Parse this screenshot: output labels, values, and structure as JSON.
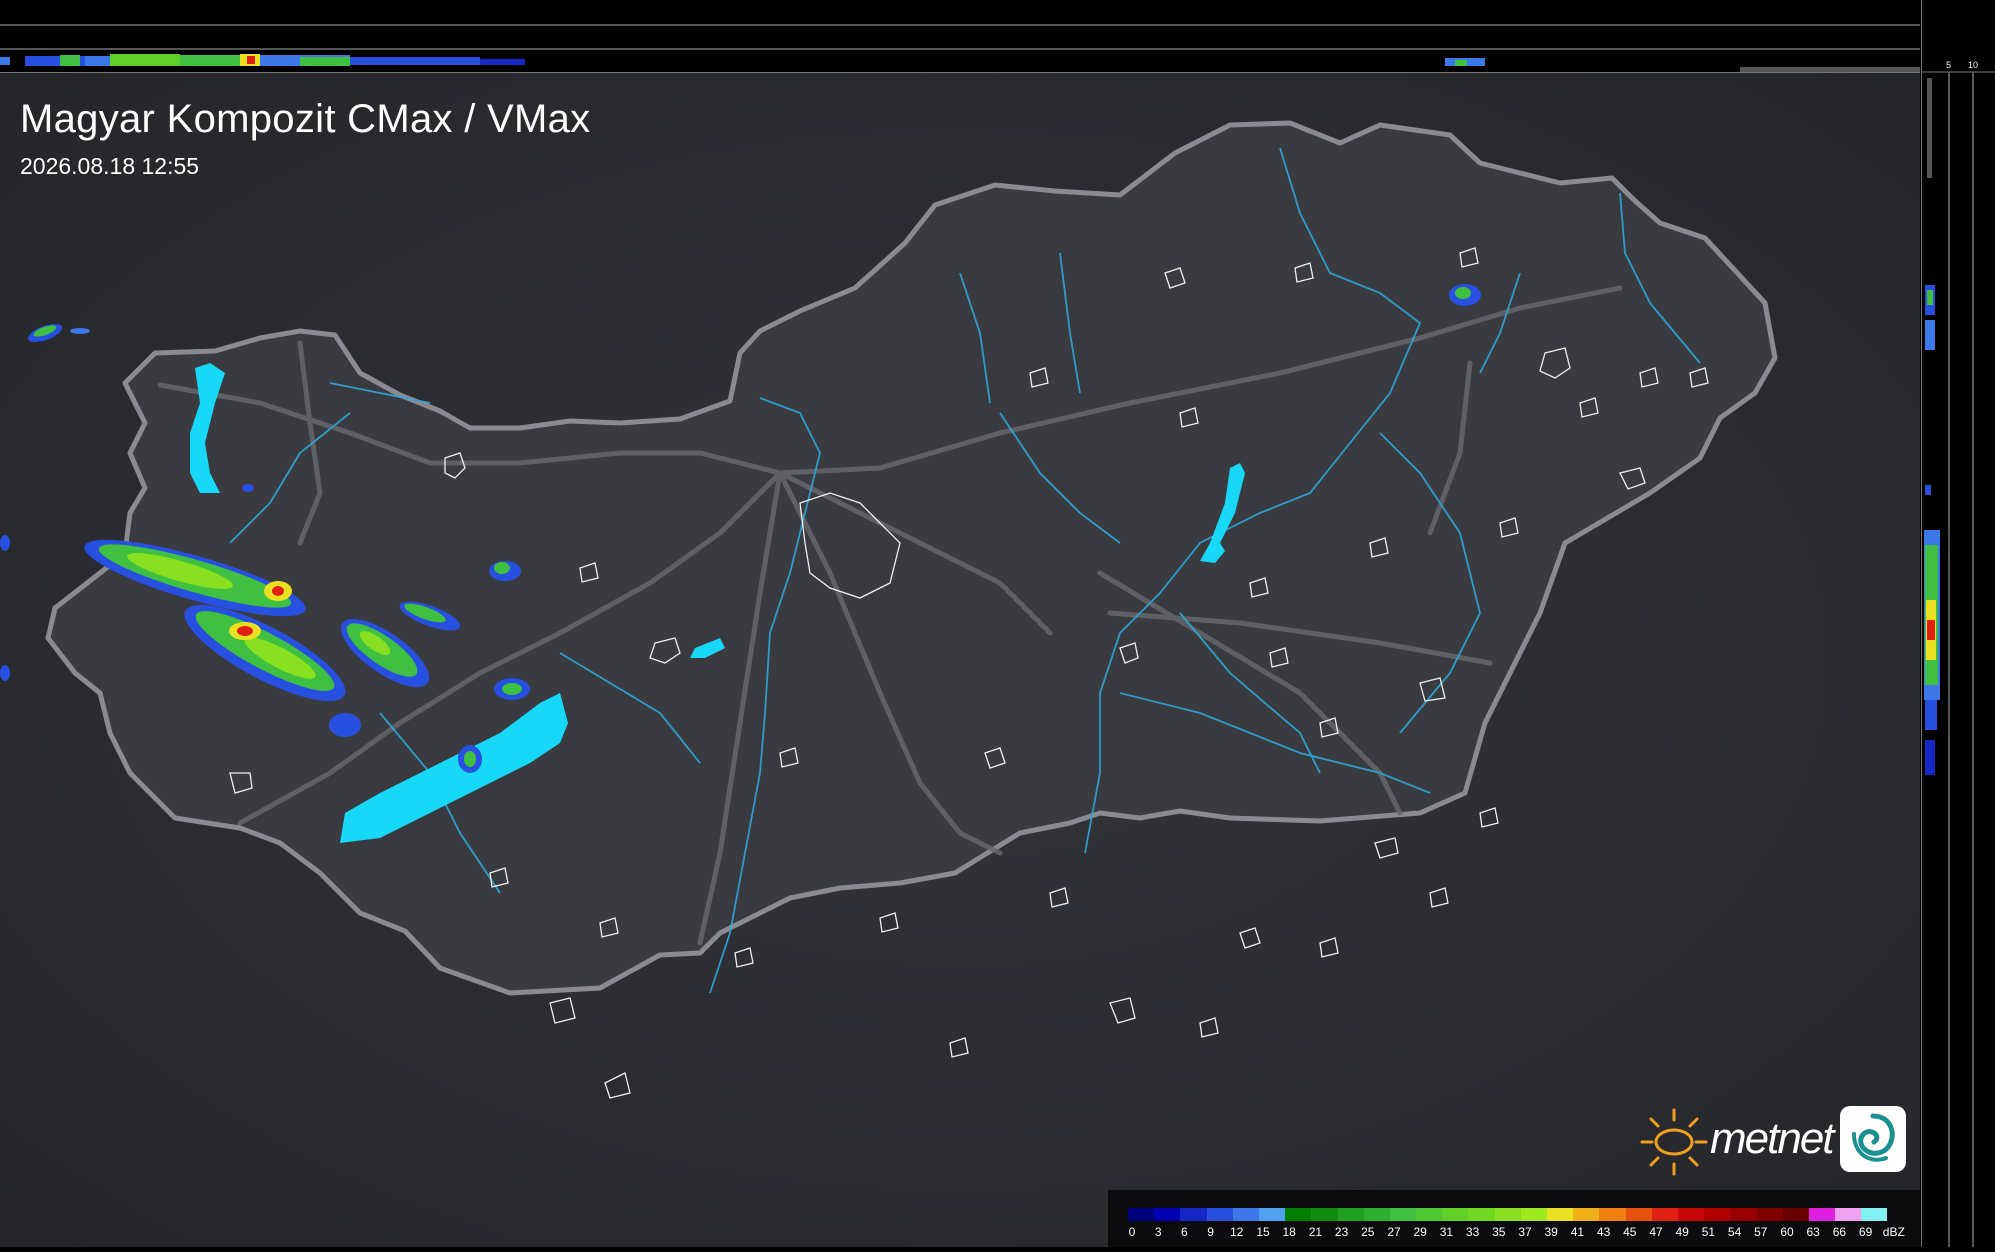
{
  "map": {
    "title": "Magyar Kompozit CMax / VMax",
    "timestamp": "2026.08.18 12:55"
  },
  "profile_ticks": {
    "top": [
      "10",
      "5"
    ],
    "right": [
      "5",
      "10"
    ]
  },
  "legend": {
    "unit": "dBZ",
    "labels": [
      "0",
      "3",
      "6",
      "9",
      "12",
      "15",
      "18",
      "21",
      "23",
      "25",
      "27",
      "29",
      "31",
      "33",
      "35",
      "37",
      "39",
      "41",
      "43",
      "45",
      "47",
      "49",
      "51",
      "54",
      "57",
      "60",
      "63",
      "66",
      "69"
    ],
    "colors": [
      "#00007a",
      "#0000b0",
      "#1428c8",
      "#2850e0",
      "#3c78e8",
      "#50a0f0",
      "#008000",
      "#108c10",
      "#20a020",
      "#30b030",
      "#40c040",
      "#50c830",
      "#60d028",
      "#70d820",
      "#88e020",
      "#a0e820",
      "#e8e020",
      "#f0b018",
      "#f08010",
      "#e85010",
      "#e02010",
      "#c80808",
      "#b00000",
      "#980000",
      "#800000",
      "#680000",
      "#e020e0",
      "#f0a0f0",
      "#80f0f0"
    ]
  },
  "brand": {
    "name": "metnet",
    "colors": {
      "sun": "#f0a020",
      "text": "#ffffff",
      "accent": "#1a9090"
    }
  },
  "colors": {
    "map_background": "#2b2c30",
    "country_fill": "#3a3b40",
    "border": "#8a8a90",
    "rivers": "#2fa8d8",
    "lakes": "#18d8f8"
  }
}
